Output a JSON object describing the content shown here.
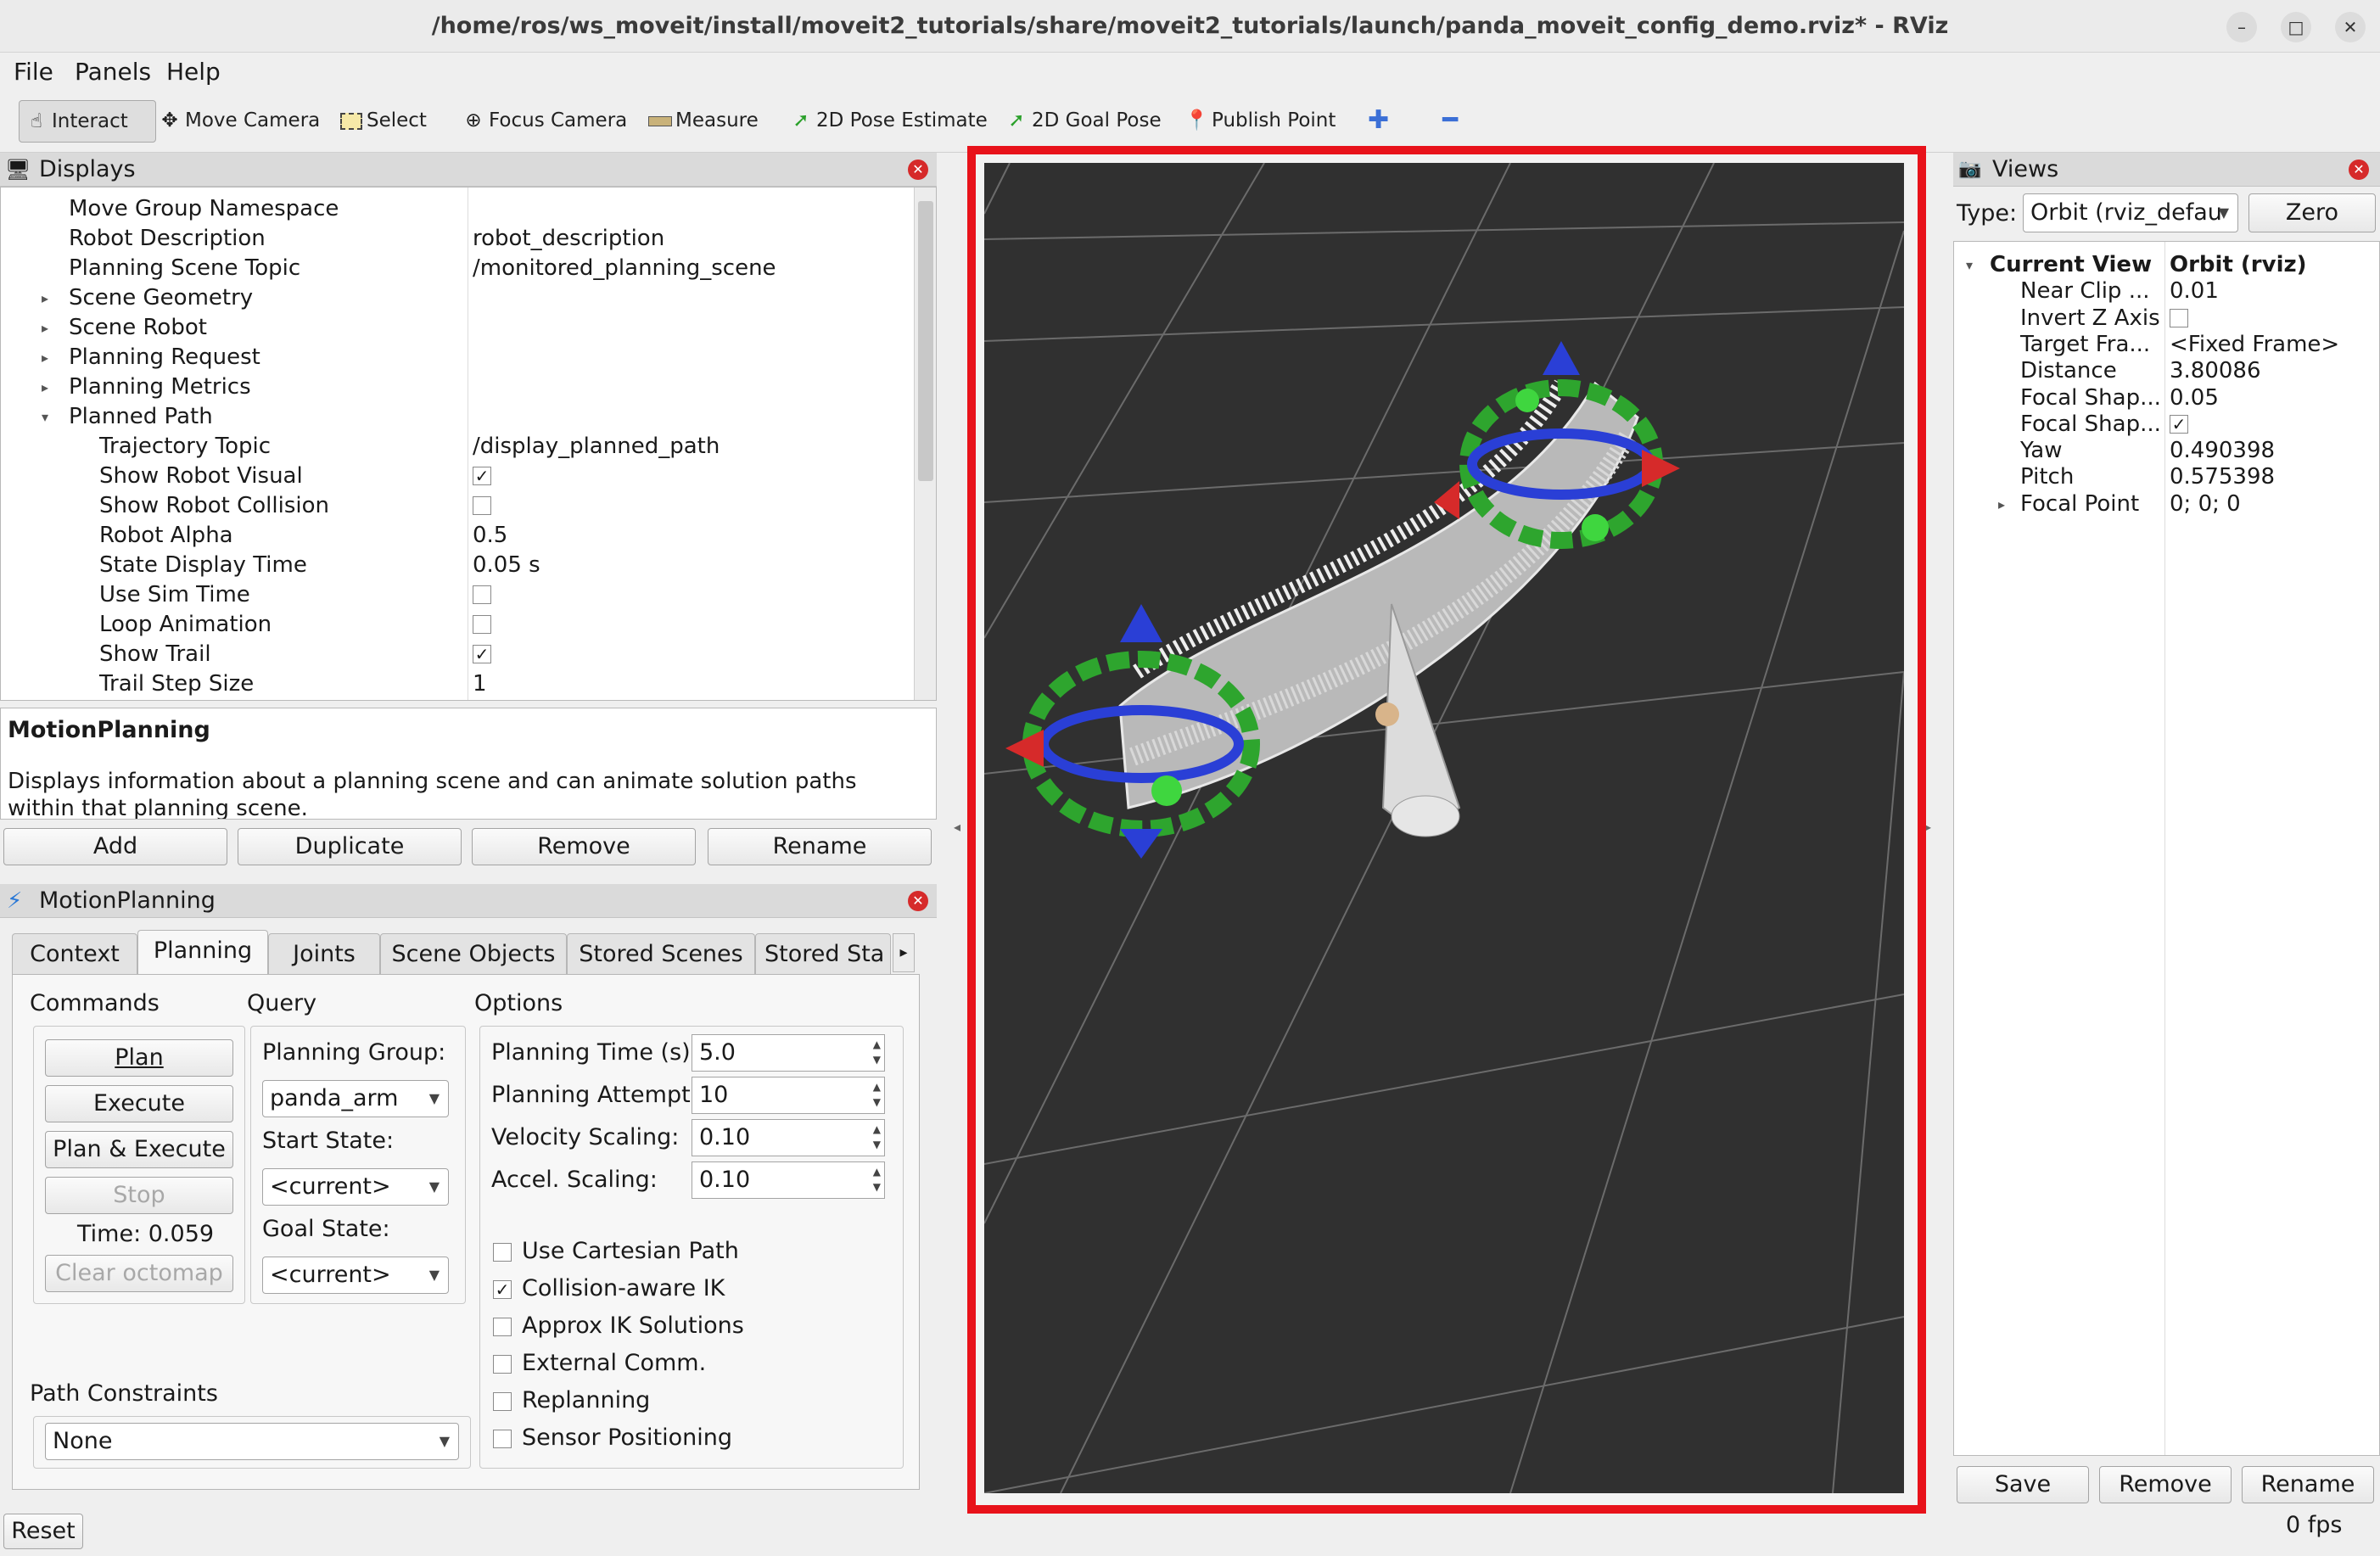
{
  "window": {
    "title": "/home/ros/ws_moveit/install/moveit2_tutorials/share/moveit2_tutorials/launch/panda_moveit_config_demo.rviz* - RViz"
  },
  "menu": {
    "file": "File",
    "panels": "Panels",
    "help": "Help"
  },
  "toolbar": {
    "interact": "Interact",
    "move_camera": "Move Camera",
    "select": "Select",
    "focus_camera": "Focus Camera",
    "measure": "Measure",
    "pose_estimate": "2D Pose Estimate",
    "goal_pose": "2D Goal Pose",
    "publish_point": "Publish Point"
  },
  "displays": {
    "header": "Displays",
    "rows": [
      {
        "name": "Move Group Namespace",
        "value": ""
      },
      {
        "name": "Robot Description",
        "value": "robot_description"
      },
      {
        "name": "Planning Scene Topic",
        "value": "/monitored_planning_scene"
      },
      {
        "name": "Scene Geometry",
        "value": ""
      },
      {
        "name": "Scene Robot",
        "value": ""
      },
      {
        "name": "Planning Request",
        "value": ""
      },
      {
        "name": "Planning Metrics",
        "value": ""
      },
      {
        "name": "Planned Path",
        "value": ""
      },
      {
        "name": "Trajectory Topic",
        "value": "/display_planned_path"
      },
      {
        "name": "Show Robot Visual",
        "value": ""
      },
      {
        "name": "Show Robot Collision",
        "value": ""
      },
      {
        "name": "Robot Alpha",
        "value": "0.5"
      },
      {
        "name": "State Display Time",
        "value": "0.05 s"
      },
      {
        "name": "Use Sim Time",
        "value": ""
      },
      {
        "name": "Loop Animation",
        "value": ""
      },
      {
        "name": "Show Trail",
        "value": ""
      },
      {
        "name": "Trail Step Size",
        "value": "1"
      }
    ],
    "description_title": "MotionPlanning",
    "description_text": "Displays information about a planning scene and can animate solution paths within that planning scene.",
    "buttons": {
      "add": "Add",
      "duplicate": "Duplicate",
      "remove": "Remove",
      "rename": "Rename"
    }
  },
  "motion_planning": {
    "header": "MotionPlanning",
    "tabs": [
      "Context",
      "Planning",
      "Joints",
      "Scene Objects",
      "Stored Scenes",
      "Stored Sta"
    ],
    "commands": {
      "title": "Commands",
      "plan": "Plan",
      "execute": "Execute",
      "plan_execute": "Plan & Execute",
      "stop": "Stop",
      "time": "Time: 0.059",
      "clear_octomap": "Clear octomap"
    },
    "query": {
      "title": "Query",
      "planning_group_label": "Planning Group:",
      "planning_group": "panda_arm",
      "start_state_label": "Start State:",
      "start_state": "<current>",
      "goal_state_label": "Goal State:",
      "goal_state": "<current>"
    },
    "options": {
      "title": "Options",
      "planning_time_label": "Planning Time (s):",
      "planning_time": "5.0",
      "planning_attempts_label": "Planning Attempts:",
      "planning_attempts": "10",
      "velocity_scaling_label": "Velocity Scaling:",
      "velocity_scaling": "0.10",
      "accel_scaling_label": "Accel. Scaling:",
      "accel_scaling": "0.10",
      "checkboxes": [
        {
          "label": "Use Cartesian Path",
          "checked": false
        },
        {
          "label": "Collision-aware IK",
          "checked": true
        },
        {
          "label": "Approx IK Solutions",
          "checked": false
        },
        {
          "label": "External Comm.",
          "checked": false
        },
        {
          "label": "Replanning",
          "checked": false
        },
        {
          "label": "Sensor Positioning",
          "checked": false
        }
      ]
    },
    "path_constraints": {
      "label": "Path Constraints",
      "value": "None"
    }
  },
  "reset": "Reset",
  "views": {
    "header": "Views",
    "type_label": "Type:",
    "type_value": "Orbit (rviz_defau",
    "zero": "Zero",
    "rows": [
      {
        "name": "Current View",
        "value": "Orbit (rviz)"
      },
      {
        "name": "Near Clip ...",
        "value": "0.01"
      },
      {
        "name": "Invert Z Axis",
        "value": ""
      },
      {
        "name": "Target Fra...",
        "value": "<Fixed Frame>"
      },
      {
        "name": "Distance",
        "value": "3.80086"
      },
      {
        "name": "Focal Shap...",
        "value": "0.05"
      },
      {
        "name": "Focal Shap...",
        "value": ""
      },
      {
        "name": "Yaw",
        "value": "0.490398"
      },
      {
        "name": "Pitch",
        "value": "0.575398"
      },
      {
        "name": "Focal Point",
        "value": "0; 0; 0"
      }
    ],
    "buttons": {
      "save": "Save",
      "remove": "Remove",
      "rename": "Rename"
    },
    "fps": "0 fps"
  },
  "colors": {
    "highlight": "#e8121a",
    "viewport_bg": "#303030",
    "grid": "#6b6b6b"
  }
}
